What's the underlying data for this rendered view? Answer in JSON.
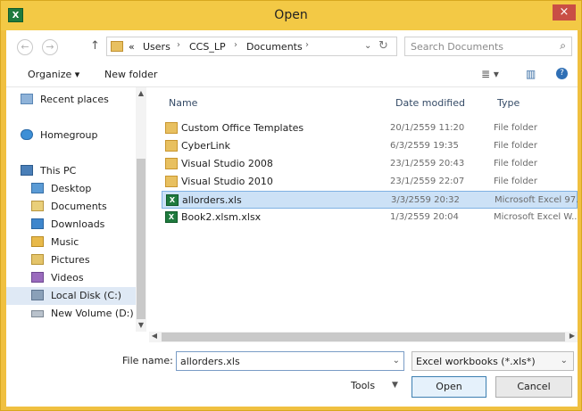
{
  "window": {
    "title": "Open",
    "app_icon": "X",
    "close": "×"
  },
  "address": {
    "back": "←",
    "forward": "→",
    "up": "↑",
    "lead": "«",
    "crumbs": [
      "Users",
      "CCS_LP",
      "Documents"
    ],
    "sep": "›",
    "dropdown": "⌄",
    "refresh": "↻",
    "search_placeholder": "Search Documents",
    "search_icon": "⌕"
  },
  "toolbar": {
    "organize": "Organize ▾",
    "new_folder": "New folder",
    "view_icon": "≣ ▾",
    "pane_icon": "▥",
    "help_icon": "?"
  },
  "nav": {
    "items": [
      {
        "label": "Recent places",
        "icon": "recent-places-icon"
      },
      {
        "label": "Homegroup",
        "icon": "homegroup-icon"
      },
      {
        "label": "This PC",
        "icon": "pc-icon"
      },
      {
        "label": "Desktop",
        "icon": "desktop-icon"
      },
      {
        "label": "Documents",
        "icon": "documents-icon"
      },
      {
        "label": "Downloads",
        "icon": "downloads-icon"
      },
      {
        "label": "Music",
        "icon": "music-icon"
      },
      {
        "label": "Pictures",
        "icon": "pictures-icon"
      },
      {
        "label": "Videos",
        "icon": "videos-icon"
      },
      {
        "label": "Local Disk (C:)",
        "icon": "disk-icon"
      },
      {
        "label": "New Volume (D:)",
        "icon": "drive-icon"
      }
    ]
  },
  "columns": {
    "name": "Name",
    "date": "Date modified",
    "type": "Type"
  },
  "files": [
    {
      "name": "Custom Office Templates",
      "date": "20/1/2559 11:20",
      "type": "File folder",
      "kind": "folder"
    },
    {
      "name": "CyberLink",
      "date": "6/3/2559 19:35",
      "type": "File folder",
      "kind": "folder"
    },
    {
      "name": "Visual Studio 2008",
      "date": "23/1/2559 20:43",
      "type": "File folder",
      "kind": "folder"
    },
    {
      "name": "Visual Studio 2010",
      "date": "23/1/2559 22:07",
      "type": "File folder",
      "kind": "folder"
    },
    {
      "name": "allorders.xls",
      "date": "3/3/2559 20:32",
      "type": "Microsoft Excel 97...",
      "kind": "xls"
    },
    {
      "name": "Book2.xlsm.xlsx",
      "date": "1/3/2559 20:04",
      "type": "Microsoft Excel W...",
      "kind": "xls"
    }
  ],
  "bottom": {
    "file_name_label": "File name:",
    "file_name_value": "allorders.xls",
    "file_type": "Excel workbooks (*.xls*)",
    "dropdown": "⌄",
    "tools": "Tools",
    "tools_dd": "▼",
    "open": "Open",
    "cancel": "Cancel"
  }
}
